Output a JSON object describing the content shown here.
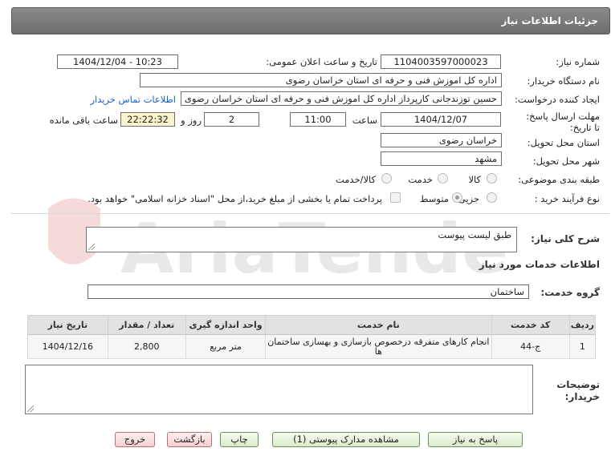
{
  "page": {
    "title": "جزئیات اطلاعات نیاز"
  },
  "form": {
    "need_number": {
      "label": "شماره نیاز:",
      "value": "1104003597000023"
    },
    "announce_datetime": {
      "label": "تاریخ و ساعت اعلان عمومی:",
      "value": "1404/12/04 - 10:23"
    },
    "buyer_org": {
      "label": "نام دستگاه خریدار:",
      "value": "اداره کل اموزش فنی و حرفه ای استان خراسان رضوی"
    },
    "requester": {
      "label": "ایجاد کننده درخواست:",
      "value": "حسین  توزندجانی کارپرداز اداره کل اموزش فنی و حرفه ای استان خراسان رضوی",
      "contact_link": "اطلاعات تماس خریدار"
    },
    "deadline": {
      "label": "مهلت ارسال پاسخ: تا تاریخ:",
      "date": "1404/12/07",
      "time_label": "ساعت",
      "time": "11:00",
      "days": "2",
      "days_label": "روز و",
      "remaining": "22:22:32",
      "remaining_label": "ساعت باقی مانده"
    },
    "province": {
      "label": "استان محل تحویل:",
      "value": "خراسان رضوی"
    },
    "city": {
      "label": "شهر محل تحویل:",
      "value": "مشهد"
    },
    "category": {
      "label": "طبقه بندی موضوعی:",
      "options": [
        "کالا",
        "خدمت",
        "کالا/خدمت"
      ],
      "selected": "خدمت"
    },
    "purchase_type": {
      "label": "نوع فرآیند خرید :",
      "options": [
        "جزیی",
        "متوسط"
      ],
      "selected": "جزیی",
      "payment_note": "پرداخت تمام یا بخشی از مبلغ خرید،از محل \"اسناد خزانه اسلامی\" خواهد بود."
    }
  },
  "description": {
    "label": "شرح کلی نیاز:",
    "value": "طبق لیست پیوست"
  },
  "services_section": {
    "title": "اطلاعات خدمات مورد نیاز"
  },
  "service_group": {
    "label": "گروه خدمت:",
    "value": "ساختمان"
  },
  "table": {
    "headers": [
      "ردیف",
      "کد خدمت",
      "نام خدمت",
      "واحد اندازه گیری",
      "تعداد / مقدار",
      "تاریخ نیاز"
    ],
    "rows": [
      [
        "1",
        "ج-44",
        "انجام کارهای متفرقه درخصوص بازسازی و بهسازی ساختمان ها",
        "متر مربع",
        "2,800",
        "1404/12/16"
      ]
    ]
  },
  "buyer_notes": {
    "label": "توضیحات خریدار:",
    "value": ""
  },
  "buttons": {
    "reply": "پاسخ به نیاز",
    "view_docs": "مشاهده مدارک پیوستی (1)",
    "print": "چاپ",
    "back": "بازگشت",
    "exit": "خروج"
  },
  "watermark": {
    "text": "AriaTender.neT"
  },
  "colors": {
    "titlebar": "#777777",
    "link": "#1a62c7",
    "remaining_bg": "#fbf3c9",
    "button_green": "#d9ecc9",
    "button_red": "#f6cfcf"
  }
}
